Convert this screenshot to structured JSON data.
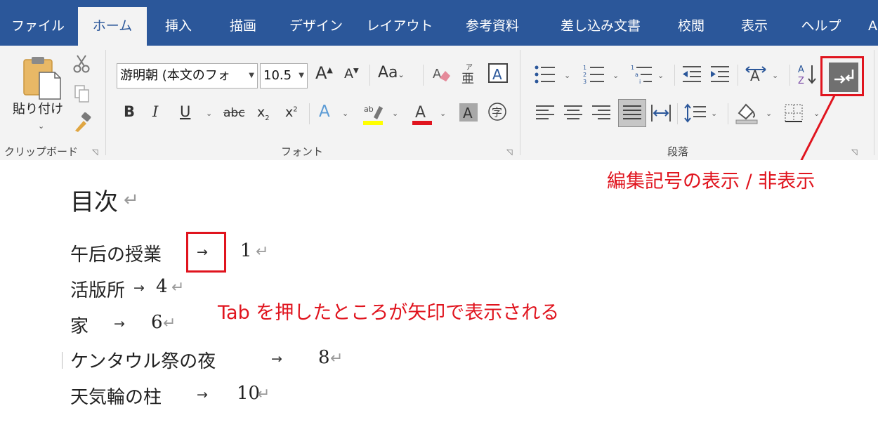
{
  "tabs": [
    {
      "label": "ファイル",
      "active": false
    },
    {
      "label": "ホーム",
      "active": true
    },
    {
      "label": "挿入",
      "active": false
    },
    {
      "label": "描画",
      "active": false
    },
    {
      "label": "デザイン",
      "active": false
    },
    {
      "label": "レイアウト",
      "active": false
    },
    {
      "label": "参考資料",
      "active": false
    },
    {
      "label": "差し込み文書",
      "active": false
    },
    {
      "label": "校閲",
      "active": false
    },
    {
      "label": "表示",
      "active": false
    },
    {
      "label": "ヘルプ",
      "active": false
    },
    {
      "label": "A",
      "active": false
    }
  ],
  "ribbon": {
    "clipboard": {
      "paste_label": "貼り付け",
      "group_label": "クリップボード"
    },
    "font": {
      "font_name": "游明朝 (本文のフォ",
      "font_size": "10.5",
      "group_label": "フォント"
    },
    "paragraph": {
      "group_label": "段落"
    }
  },
  "document": {
    "heading": "目次",
    "rows": [
      {
        "title": "午后の授業",
        "page": "1"
      },
      {
        "title": "活版所",
        "page": "4"
      },
      {
        "title": "家",
        "page": "6"
      },
      {
        "title": "ケンタウル祭の夜",
        "page": "8"
      },
      {
        "title": "天気輪の柱",
        "page": "10"
      }
    ],
    "tab_mark": "→",
    "para_mark": "↵"
  },
  "annotations": {
    "top": "編集記号の表示 / 非表示",
    "middle": "Tab を押したところが矢印で表示される"
  },
  "colors": {
    "tabbar": "#2b579a",
    "ribbon": "#f3f3f3",
    "annotation_red": "#e0141e"
  }
}
